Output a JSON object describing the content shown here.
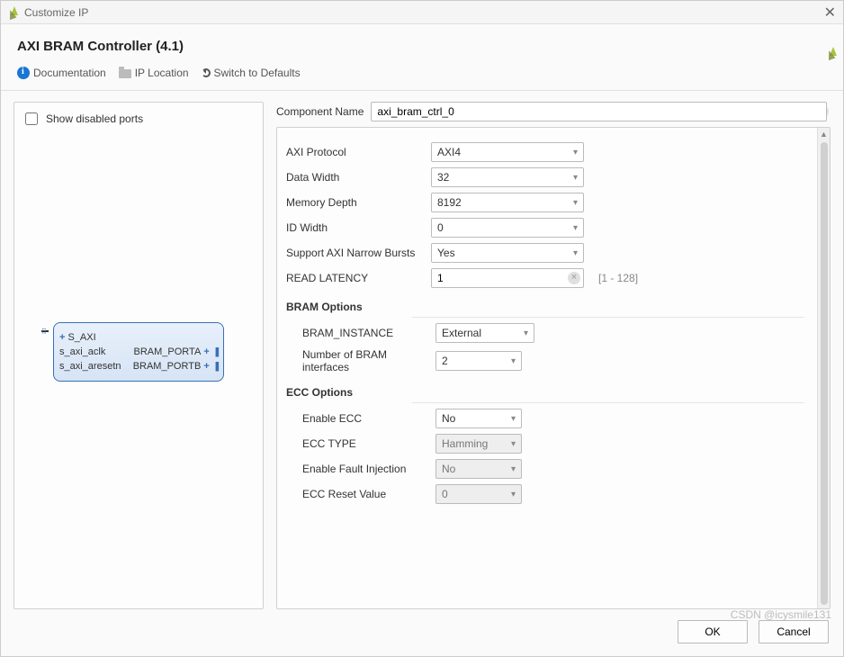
{
  "window": {
    "title": "Customize IP",
    "close_label": "✕"
  },
  "header": {
    "title": "AXI BRAM Controller (4.1)"
  },
  "toolbar": {
    "documentation": "Documentation",
    "ip_location": "IP Location",
    "switch_defaults": "Switch to Defaults"
  },
  "left_panel": {
    "show_disabled_label": "Show disabled ports",
    "show_disabled_checked": false,
    "ip_ports": {
      "left": [
        "S_AXI",
        "s_axi_aclk",
        "s_axi_aresetn"
      ],
      "right": [
        "BRAM_PORTA",
        "BRAM_PORTB"
      ]
    }
  },
  "component_name": {
    "label": "Component Name",
    "value": "axi_bram_ctrl_0"
  },
  "config": {
    "axi_protocol": {
      "label": "AXI Protocol",
      "value": "AXI4"
    },
    "data_width": {
      "label": "Data Width",
      "value": "32"
    },
    "memory_depth": {
      "label": "Memory Depth",
      "value": "8192"
    },
    "id_width": {
      "label": "ID Width",
      "value": "0"
    },
    "narrow_bursts": {
      "label": "Support AXI Narrow Bursts",
      "value": "Yes"
    },
    "read_latency": {
      "label": "READ LATENCY",
      "value": "1",
      "hint": "[1 - 128]"
    }
  },
  "bram_options": {
    "header": "BRAM Options",
    "instance": {
      "label": "BRAM_INSTANCE",
      "value": "External"
    },
    "num_if": {
      "label": "Number of BRAM interfaces",
      "value": "2"
    }
  },
  "ecc_options": {
    "header": "ECC Options",
    "enable_ecc": {
      "label": "Enable ECC",
      "value": "No"
    },
    "ecc_type": {
      "label": "ECC TYPE",
      "value": "Hamming",
      "disabled": true
    },
    "fault_inj": {
      "label": "Enable Fault Injection",
      "value": "No",
      "disabled": true
    },
    "reset_val": {
      "label": "ECC Reset Value",
      "value": "0",
      "disabled": true
    }
  },
  "footer": {
    "ok": "OK",
    "cancel": "Cancel"
  },
  "watermark": "CSDN @icysmile131"
}
